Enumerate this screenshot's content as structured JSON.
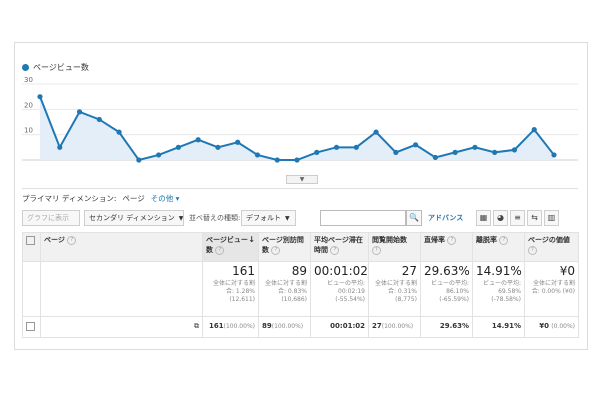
{
  "chart_data": {
    "type": "area",
    "series": [
      {
        "name": "ページビュー数",
        "values": [
          25,
          5,
          19,
          16,
          11,
          0,
          2,
          5,
          8,
          5,
          7,
          2,
          0,
          0,
          3,
          5,
          5,
          11,
          3,
          6,
          1,
          3,
          5,
          3,
          4,
          12,
          2
        ]
      }
    ],
    "y_ticks": [
      "30",
      "20",
      "10"
    ],
    "ylim": [
      0,
      30
    ],
    "grid": true,
    "color": "#1f78b4",
    "fill": "#e3eef8"
  },
  "dimension": {
    "label": "プライマリ ディメンション:",
    "value": "ページ",
    "other": "その他"
  },
  "toolbar": {
    "graph_btn": "グラフに表示",
    "secondary": "セカンダリ ディメンション",
    "sort_label": "並べ替えの種類:",
    "sort_value": "デフォルト",
    "search_icon": "🔍",
    "advanced": "アドバンス"
  },
  "table": {
    "headers": {
      "page": "ページ",
      "pageviews": "ページビュー数",
      "unique": "ページ別訪問数",
      "avg_time": "平均ページ滞在時間",
      "entrances": "閲覧開始数",
      "bounce": "直帰率",
      "exit": "離脱率",
      "value": "ページの価値"
    },
    "totals": {
      "pageviews": "161",
      "pageviews_sub": "全体に対する割合: 1.28% (12,611)",
      "unique": "89",
      "unique_sub": "全体に対する割合: 0.83% (10,686)",
      "avg_time": "00:01:02",
      "avg_time_sub": "ビューの平均: 00:02:19 (-55.54%)",
      "entrances": "27",
      "entrances_sub": "全体に対する割合: 0.31% (8,775)",
      "bounce": "29.63%",
      "bounce_sub": "ビューの平均: 86.10% (-65.59%)",
      "exit": "14.91%",
      "exit_sub": "ビューの平均: 69.58% (-78.58%)",
      "value": "¥0",
      "value_sub": "全体に対する割合: 0.00% (¥0)"
    },
    "row": {
      "pageviews": "161",
      "pageviews_pct": "(100.00%)",
      "unique": "89",
      "unique_pct": "(100.00%)",
      "avg_time": "00:01:02",
      "entrances": "27",
      "entrances_pct": "(100.00%)",
      "bounce": "29.63%",
      "exit": "14.91%",
      "value": "¥0",
      "value_pct": "(0.00%)"
    }
  }
}
